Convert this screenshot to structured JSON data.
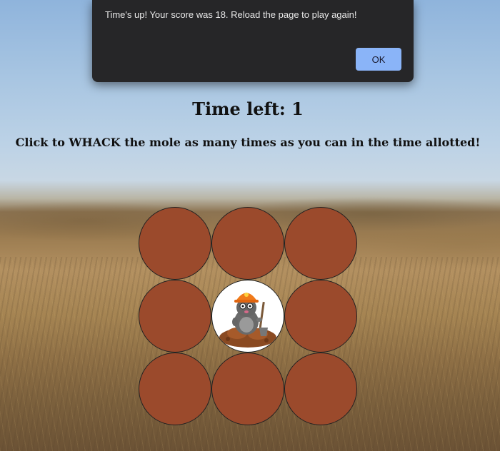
{
  "dialog": {
    "message": "Time's up! Your score was 18. Reload the page to play again!",
    "ok_label": "OK"
  },
  "game": {
    "time_left_text": "Time left: 1",
    "instruction": "Click to WHACK the mole as many times as you can in the time allotted!",
    "holes": [
      {
        "has_mole": false
      },
      {
        "has_mole": false
      },
      {
        "has_mole": false
      },
      {
        "has_mole": false
      },
      {
        "has_mole": true
      },
      {
        "has_mole": false
      },
      {
        "has_mole": false
      },
      {
        "has_mole": false
      },
      {
        "has_mole": false
      }
    ]
  },
  "colors": {
    "hole": "#9b4a2c",
    "mole_hole": "#ffffff",
    "dialog_bg": "#262628",
    "ok_button": "#8ab4f8"
  },
  "icons": {
    "mole": "mole-with-hardhat-icon"
  }
}
